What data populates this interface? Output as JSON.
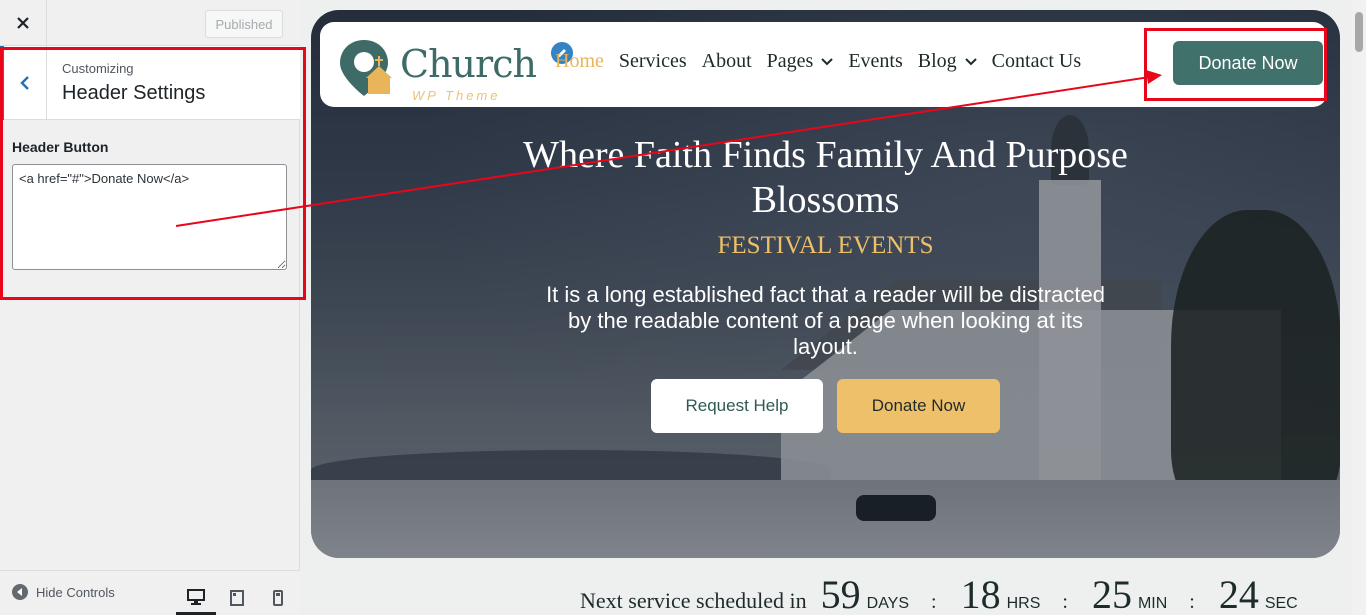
{
  "customizer": {
    "close_icon": "close-icon",
    "publish_label": "Published",
    "customizing_label": "Customizing",
    "section_title": "Header Settings",
    "field_label": "Header Button",
    "field_value": "<a href=\"#\">Donate Now</a>",
    "hide_controls_label": "Hide Controls"
  },
  "site": {
    "logo_name": "Church",
    "logo_tagline": "WP Theme",
    "nav": [
      {
        "label": "Home",
        "active": true
      },
      {
        "label": "Services"
      },
      {
        "label": "About"
      },
      {
        "label": "Pages",
        "dropdown": true
      },
      {
        "label": "Events"
      },
      {
        "label": "Blog",
        "dropdown": true
      },
      {
        "label": "Contact Us"
      }
    ],
    "header_button": "Donate Now"
  },
  "hero": {
    "title": "Where Faith Finds Family And Purpose Blossoms",
    "subtitle": "FESTIVAL EVENTS",
    "text": "It is a long established fact that a reader will be distracted by the readable content of a page when looking at its layout.",
    "btn_request": "Request Help",
    "btn_donate": "Donate Now"
  },
  "countdown": {
    "label": "Next service scheduled in",
    "days": "59",
    "days_unit": "DAYS",
    "hrs": "18",
    "hrs_unit": "HRS",
    "min": "25",
    "min_unit": "MIN",
    "sec": "24",
    "sec_unit": "SEC",
    "separator": ":"
  },
  "colors": {
    "accent_red": "#e8061a",
    "brand_teal": "#41716b",
    "brand_gold": "#efc06a",
    "wp_blue": "#2271b1"
  }
}
